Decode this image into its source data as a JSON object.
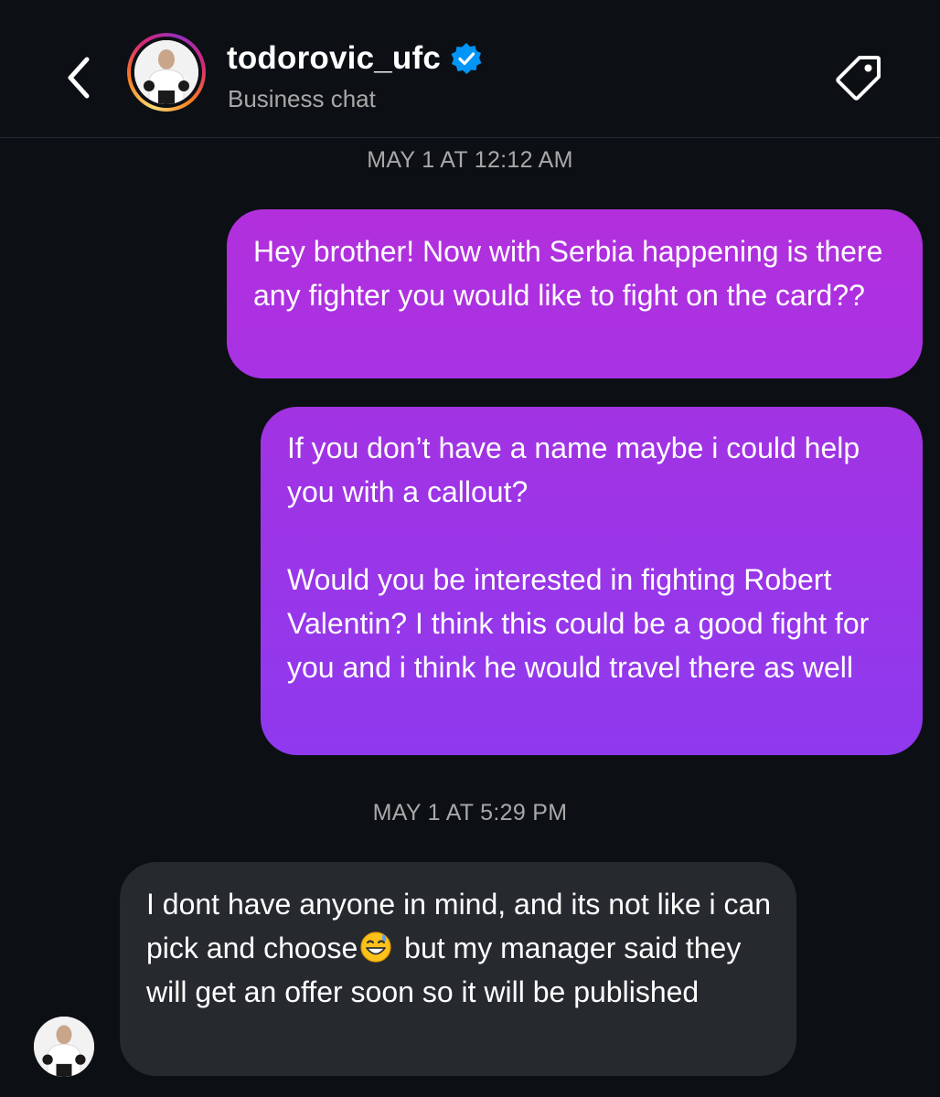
{
  "header": {
    "username": "todorovic_ufc",
    "subtitle": "Business chat",
    "icons": {
      "back": "chevron-left-icon",
      "verified": "verified-badge-icon",
      "tag": "tag-icon"
    }
  },
  "messages": [
    {
      "type": "timestamp",
      "text": "MAY 1 AT 12:12 AM"
    },
    {
      "type": "outgoing",
      "text": "Hey brother! Now with Serbia happening is there any fighter you would like to fight on the card??"
    },
    {
      "type": "outgoing",
      "text": "If you don’t have a name maybe i could help you with a callout?\n\nWould you be interested in fighting Robert Valentin? I think this could be a good fight for you and i think he would travel there as well"
    },
    {
      "type": "timestamp",
      "text": "MAY 1 AT 5:29 PM"
    },
    {
      "type": "incoming",
      "text_before_emoji": "I dont have anyone in mind, and its not like i can pick and choose",
      "emoji": "grinning-face-with-sweat-emoji",
      "text_after_emoji": " but my manager said they will get an offer soon so it will be published"
    }
  ],
  "colors": {
    "background": "#0c1014",
    "outgoing_gradient_top": "#b22fdc",
    "outgoing_gradient_bottom": "#8f39ee",
    "incoming_bubble": "#262a2f",
    "secondary_text": "#a8a8a8",
    "verified_blue": "#0095f6"
  }
}
